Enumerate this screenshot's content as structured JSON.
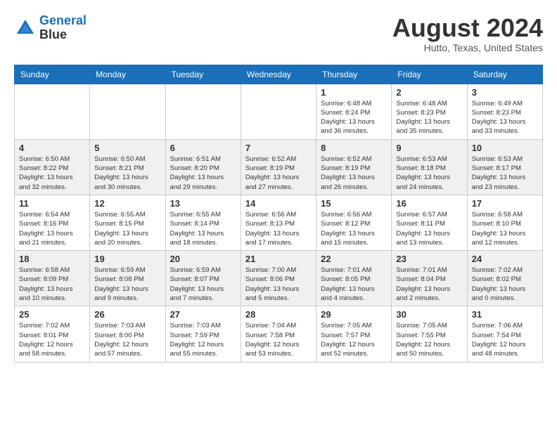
{
  "header": {
    "logo_line1": "General",
    "logo_line2": "Blue",
    "month_year": "August 2024",
    "location": "Hutto, Texas, United States"
  },
  "days_of_week": [
    "Sunday",
    "Monday",
    "Tuesday",
    "Wednesday",
    "Thursday",
    "Friday",
    "Saturday"
  ],
  "weeks": [
    [
      {
        "day": "",
        "info": ""
      },
      {
        "day": "",
        "info": ""
      },
      {
        "day": "",
        "info": ""
      },
      {
        "day": "",
        "info": ""
      },
      {
        "day": "1",
        "info": "Sunrise: 6:48 AM\nSunset: 8:24 PM\nDaylight: 13 hours\nand 36 minutes."
      },
      {
        "day": "2",
        "info": "Sunrise: 6:48 AM\nSunset: 8:23 PM\nDaylight: 13 hours\nand 35 minutes."
      },
      {
        "day": "3",
        "info": "Sunrise: 6:49 AM\nSunset: 8:23 PM\nDaylight: 13 hours\nand 33 minutes."
      }
    ],
    [
      {
        "day": "4",
        "info": "Sunrise: 6:50 AM\nSunset: 8:22 PM\nDaylight: 13 hours\nand 32 minutes."
      },
      {
        "day": "5",
        "info": "Sunrise: 6:50 AM\nSunset: 8:21 PM\nDaylight: 13 hours\nand 30 minutes."
      },
      {
        "day": "6",
        "info": "Sunrise: 6:51 AM\nSunset: 8:20 PM\nDaylight: 13 hours\nand 29 minutes."
      },
      {
        "day": "7",
        "info": "Sunrise: 6:52 AM\nSunset: 8:19 PM\nDaylight: 13 hours\nand 27 minutes."
      },
      {
        "day": "8",
        "info": "Sunrise: 6:52 AM\nSunset: 8:19 PM\nDaylight: 13 hours\nand 26 minutes."
      },
      {
        "day": "9",
        "info": "Sunrise: 6:53 AM\nSunset: 8:18 PM\nDaylight: 13 hours\nand 24 minutes."
      },
      {
        "day": "10",
        "info": "Sunrise: 6:53 AM\nSunset: 8:17 PM\nDaylight: 13 hours\nand 23 minutes."
      }
    ],
    [
      {
        "day": "11",
        "info": "Sunrise: 6:54 AM\nSunset: 8:16 PM\nDaylight: 13 hours\nand 21 minutes."
      },
      {
        "day": "12",
        "info": "Sunrise: 6:55 AM\nSunset: 8:15 PM\nDaylight: 13 hours\nand 20 minutes."
      },
      {
        "day": "13",
        "info": "Sunrise: 6:55 AM\nSunset: 8:14 PM\nDaylight: 13 hours\nand 18 minutes."
      },
      {
        "day": "14",
        "info": "Sunrise: 6:56 AM\nSunset: 8:13 PM\nDaylight: 13 hours\nand 17 minutes."
      },
      {
        "day": "15",
        "info": "Sunrise: 6:56 AM\nSunset: 8:12 PM\nDaylight: 13 hours\nand 15 minutes."
      },
      {
        "day": "16",
        "info": "Sunrise: 6:57 AM\nSunset: 8:11 PM\nDaylight: 13 hours\nand 13 minutes."
      },
      {
        "day": "17",
        "info": "Sunrise: 6:58 AM\nSunset: 8:10 PM\nDaylight: 13 hours\nand 12 minutes."
      }
    ],
    [
      {
        "day": "18",
        "info": "Sunrise: 6:58 AM\nSunset: 8:09 PM\nDaylight: 13 hours\nand 10 minutes."
      },
      {
        "day": "19",
        "info": "Sunrise: 6:59 AM\nSunset: 8:08 PM\nDaylight: 13 hours\nand 9 minutes."
      },
      {
        "day": "20",
        "info": "Sunrise: 6:59 AM\nSunset: 8:07 PM\nDaylight: 13 hours\nand 7 minutes."
      },
      {
        "day": "21",
        "info": "Sunrise: 7:00 AM\nSunset: 8:06 PM\nDaylight: 13 hours\nand 5 minutes."
      },
      {
        "day": "22",
        "info": "Sunrise: 7:01 AM\nSunset: 8:05 PM\nDaylight: 13 hours\nand 4 minutes."
      },
      {
        "day": "23",
        "info": "Sunrise: 7:01 AM\nSunset: 8:04 PM\nDaylight: 13 hours\nand 2 minutes."
      },
      {
        "day": "24",
        "info": "Sunrise: 7:02 AM\nSunset: 8:02 PM\nDaylight: 13 hours\nand 0 minutes."
      }
    ],
    [
      {
        "day": "25",
        "info": "Sunrise: 7:02 AM\nSunset: 8:01 PM\nDaylight: 12 hours\nand 58 minutes."
      },
      {
        "day": "26",
        "info": "Sunrise: 7:03 AM\nSunset: 8:00 PM\nDaylight: 12 hours\nand 57 minutes."
      },
      {
        "day": "27",
        "info": "Sunrise: 7:03 AM\nSunset: 7:59 PM\nDaylight: 12 hours\nand 55 minutes."
      },
      {
        "day": "28",
        "info": "Sunrise: 7:04 AM\nSunset: 7:58 PM\nDaylight: 12 hours\nand 53 minutes."
      },
      {
        "day": "29",
        "info": "Sunrise: 7:05 AM\nSunset: 7:57 PM\nDaylight: 12 hours\nand 52 minutes."
      },
      {
        "day": "30",
        "info": "Sunrise: 7:05 AM\nSunset: 7:55 PM\nDaylight: 12 hours\nand 50 minutes."
      },
      {
        "day": "31",
        "info": "Sunrise: 7:06 AM\nSunset: 7:54 PM\nDaylight: 12 hours\nand 48 minutes."
      }
    ]
  ]
}
